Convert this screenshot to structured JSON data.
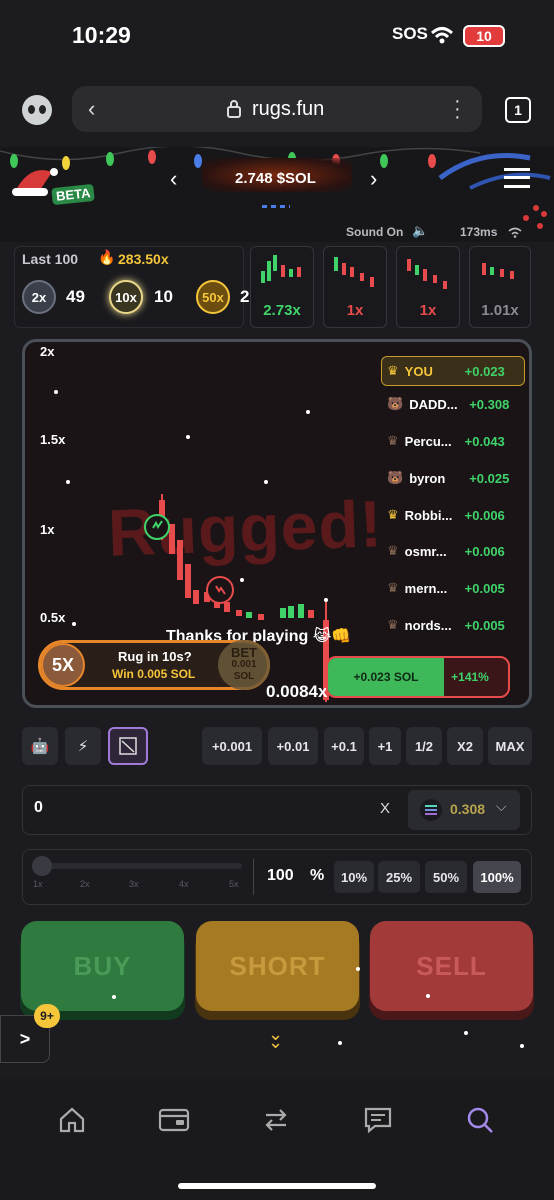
{
  "status": {
    "time": "10:29",
    "sos": "SOS",
    "battery": "10"
  },
  "browser": {
    "url": "rugs.fun",
    "tabs": "1"
  },
  "header": {
    "badge": "BETA",
    "price": "2.748 $SOL"
  },
  "connection": {
    "sound": "Sound On",
    "latency": "173ms"
  },
  "last": {
    "label": "Last 100",
    "top_multiplier": "283.50x",
    "counters": [
      {
        "badge": "2x",
        "count": "49"
      },
      {
        "badge": "10x",
        "count": "10"
      },
      {
        "badge": "50x",
        "count": "2"
      }
    ],
    "recent_rounds": [
      "2.73x",
      "1x",
      "1x",
      "1.01x"
    ]
  },
  "chart": {
    "y_labels": [
      "2x",
      "1.5x",
      "1x",
      "0.5x"
    ],
    "rugged_text": "Rugged!",
    "thanks": "Thanks for playing 😹👊",
    "current": "0.0084x"
  },
  "leaderboard": [
    {
      "name": "YOU",
      "value": "+0.023"
    },
    {
      "name": "DADD...",
      "value": "+0.308"
    },
    {
      "name": "Percu...",
      "value": "+0.043"
    },
    {
      "name": "byron",
      "value": "+0.025"
    },
    {
      "name": "Robbi...",
      "value": "+0.006"
    },
    {
      "name": "osmr...",
      "value": "+0.006"
    },
    {
      "name": "mern...",
      "value": "+0.005"
    },
    {
      "name": "nords...",
      "value": "+0.005"
    }
  ],
  "side_bet": {
    "multiplier": "5X",
    "title": "Rug in 10s?",
    "win": "Win 0.005 SOL",
    "bet_label": "BET",
    "bet_amount": "0.001",
    "bet_unit": "SOL"
  },
  "position": {
    "pnl": "+0.023 SOL",
    "pct": "+141%"
  },
  "amount_buttons": [
    "+0.001",
    "+0.01",
    "+0.1",
    "+1",
    "1/2",
    "X2",
    "MAX"
  ],
  "input": {
    "value": "0",
    "clear": "X",
    "balance": "0.308"
  },
  "slider": {
    "ticks": [
      "1x",
      "2x",
      "3x",
      "4x",
      "5x"
    ],
    "value": "100",
    "unit": "%",
    "presets": [
      "10%",
      "25%",
      "50%",
      "100%"
    ]
  },
  "actions": {
    "buy": "BUY",
    "short": "SHORT",
    "sell": "SELL"
  },
  "notification": {
    "count": "9+",
    "toggle": ">"
  },
  "colors": {
    "buy": "#1e7a3e",
    "short": "#a7781c",
    "sell": "#a83838",
    "accent": "#f5c53a"
  }
}
